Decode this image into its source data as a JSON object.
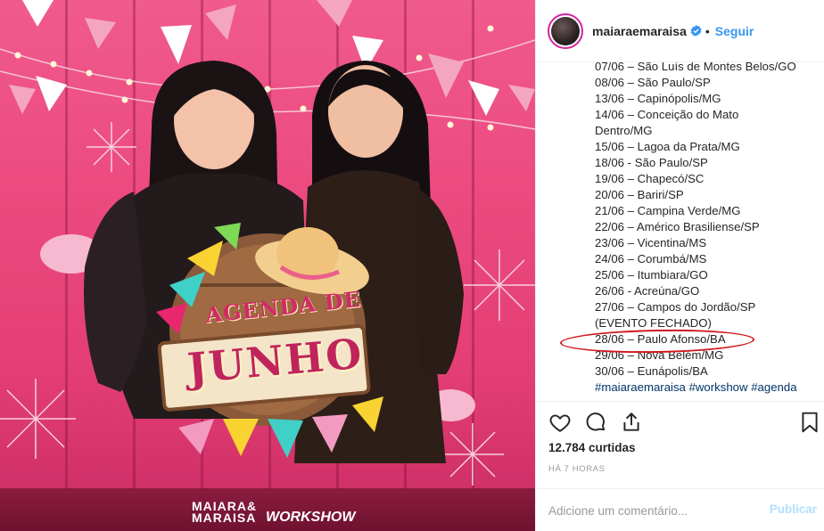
{
  "colors": {
    "link": "#3897f0",
    "hashtag": "#003569",
    "muted": "#999999",
    "annotation": "#d0181f",
    "poster_bg": "#ec4b80"
  },
  "poster": {
    "title_line1": "AGENDA DE",
    "title_line2": "JUNHO",
    "brand_top": "MAIARA&",
    "brand_bottom": "MARAISA",
    "brand_workshow": "WORKSHOW"
  },
  "header": {
    "username": "maiaraemaraisa",
    "verified_icon": "verified-badge-icon",
    "separator": "•",
    "follow_label": "Seguir"
  },
  "caption": {
    "lines": [
      "07/06 – São Luís de Montes Belos/GO",
      "08/06 – São Paulo/SP",
      "13/06 – Capinópolis/MG",
      "14/06 – Conceição do Mato",
      "Dentro/MG",
      "15/06 – Lagoa da Prata/MG",
      "18/06 - São Paulo/SP",
      "19/06 – Chapecó/SC",
      "20/06 – Bariri/SP",
      "21/06 – Campina Verde/MG",
      "22/06 – Américo Brasiliense/SP",
      "23/06 – Vicentina/MS",
      "24/06 – Corumbá/MS",
      "25/06 – Itumbiara/GO",
      "26/06 - Acreúna/GO",
      "27/06 – Campos do Jordão/SP",
      "(EVENTO FECHADO)",
      "28/06 – Paulo Afonso/BA",
      "29/06 – Nova Belém/MG",
      "30/06 – Eunápolis/BA"
    ],
    "hashtags": [
      "#maiaraemaraisa",
      "#workshow",
      "#agenda"
    ]
  },
  "actions": {
    "like_icon": "heart-icon",
    "comment_icon": "comment-bubble-icon",
    "share_icon": "share-upload-icon",
    "save_icon": "bookmark-icon"
  },
  "likes_text": "12.784 curtidas",
  "time_text": "HÁ 7 HORAS",
  "comment": {
    "placeholder": "Adicione um comentário...",
    "publish_label": "Publicar"
  }
}
